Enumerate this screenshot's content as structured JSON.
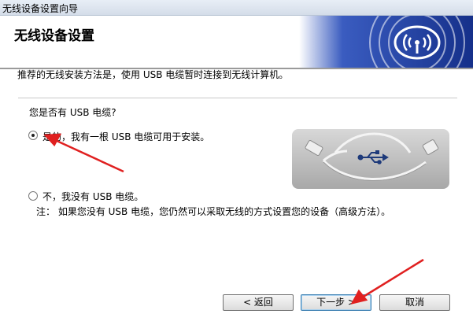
{
  "window": {
    "title": "无线设备设置向导"
  },
  "header": {
    "title": "无线设备设置",
    "logo": "wireless-wave-icon"
  },
  "intro": "推荐的无线安装方法是，使用 USB 电缆暂时连接到无线计算机。",
  "question": "您是否有 USB 电缆?",
  "options": [
    {
      "label": "是的，我有一根 USB 电缆可用于安装。",
      "selected": true
    },
    {
      "label": "不，我没有 USB 电缆。",
      "selected": false
    }
  ],
  "note": "注：  如果您没有 USB 电缆，您仍然可以采取无线的方式设置您的设备（高级方法）。",
  "buttons": {
    "back": "< 返回",
    "next": "下一步 >",
    "cancel": "取消"
  },
  "colors": {
    "banner": "#1f3f9e",
    "annotation_arrow": "#e02020"
  }
}
